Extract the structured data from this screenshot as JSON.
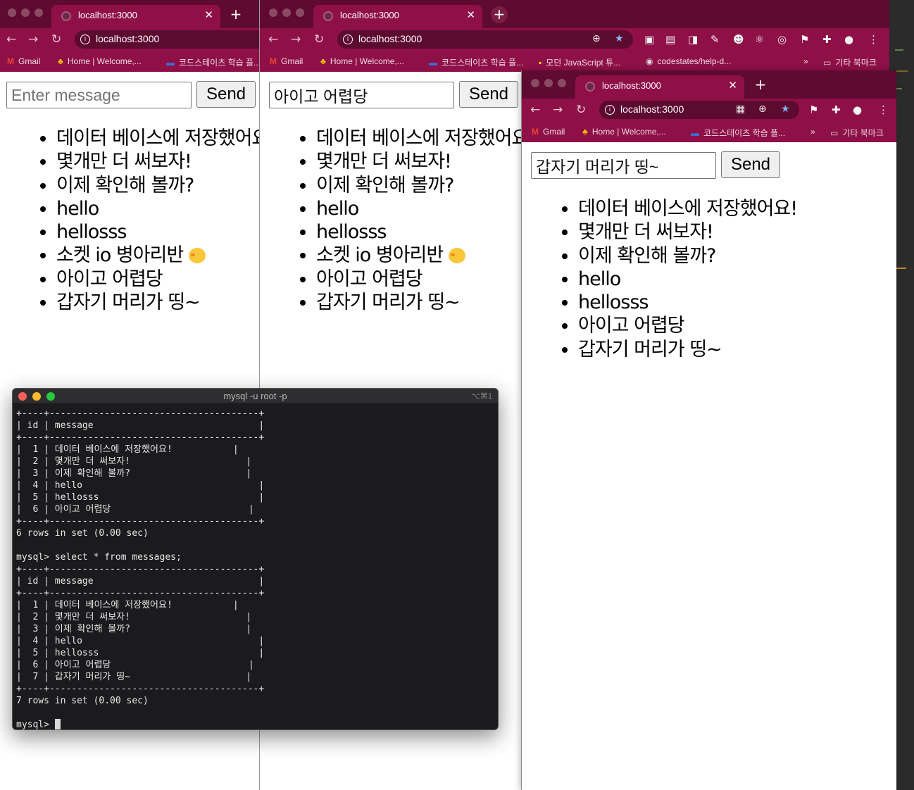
{
  "browser": {
    "tab_title": "localhost:3000",
    "url": "localhost:3000",
    "tab_close": "✕",
    "new_tab": "+",
    "bookmarks": {
      "gmail": "Gmail",
      "home": "Home | Welcome,...",
      "codestates": "코드스테이츠 학습 플...",
      "js_tutorial": "모던 JavaScript 튜...",
      "help_desk": "codestates/help-d...",
      "more": "»",
      "other_bookmarks": "기타 북마크"
    }
  },
  "windows": [
    {
      "input_value": "",
      "input_placeholder": "Enter message",
      "send_label": "Send",
      "messages": [
        "데이터 베이스에 저장했어요!",
        "몇개만 더 써보자!",
        "이제 확인해 볼까?",
        "hello",
        "hellosss",
        "소켓 io 병아리반",
        "아이고 어렵당",
        "갑자기 머리가 띵~"
      ]
    },
    {
      "input_value": "아이고 어렵당",
      "input_placeholder": "Enter message",
      "send_label": "Send",
      "messages": [
        "데이터 베이스에 저장했어요!",
        "몇개만 더 써보자!",
        "이제 확인해 볼까?",
        "hello",
        "hellosss",
        "소켓 io 병아리반",
        "아이고 어렵당",
        "갑자기 머리가 띵~"
      ]
    },
    {
      "input_value": "갑자기 머리가 띵~",
      "input_placeholder": "Enter message",
      "send_label": "Send",
      "messages": [
        "데이터 베이스에 저장했어요!",
        "몇개만 더 써보자!",
        "이제 확인해 볼까?",
        "hello",
        "hellosss",
        "아이고 어렵당",
        "갑자기 머리가 띵~"
      ]
    }
  ],
  "terminal": {
    "title": "mysql -u root -p",
    "shortcut": "⌥⌘1",
    "lines": [
      "+----+--------------------------------------+",
      "| id | message                              |",
      "+----+--------------------------------------+",
      "|  1 | 데이터 베이스에 저장했어요!           |",
      "|  2 | 몇개만 더 써보자!                     |",
      "|  3 | 이제 확인해 볼까?                     |",
      "|  4 | hello                                |",
      "|  5 | hellosss                             |",
      "|  6 | 아이고 어렵당                         |",
      "+----+--------------------------------------+",
      "6 rows in set (0.00 sec)",
      "",
      "mysql> select * from messages;",
      "+----+--------------------------------------+",
      "| id | message                              |",
      "+----+--------------------------------------+",
      "|  1 | 데이터 베이스에 저장했어요!           |",
      "|  2 | 몇개만 더 써보자!                     |",
      "|  3 | 이제 확인해 볼까?                     |",
      "|  4 | hello                                |",
      "|  5 | hellosss                             |",
      "|  6 | 아이고 어렵당                         |",
      "|  7 | 갑자기 머리가 띵~                     |",
      "+----+--------------------------------------+",
      "7 rows in set (0.00 sec)",
      "",
      "mysql> "
    ]
  },
  "colors": {
    "chrome_theme": "#8e1047",
    "tab_strip": "#5f0a30",
    "terminal_bg": "#1b1b1e"
  }
}
